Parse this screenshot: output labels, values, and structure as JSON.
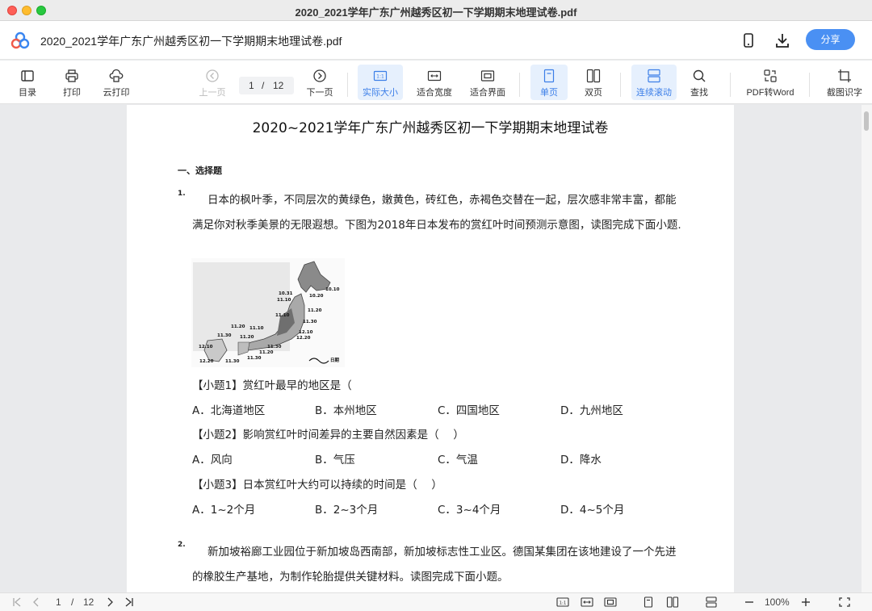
{
  "window": {
    "title": "2020_2021学年广东广州越秀区初一下学期期末地理试卷.pdf"
  },
  "header": {
    "doc_title": "2020_2021学年广东广州越秀区初一下学期期末地理试卷.pdf",
    "share_label": "分享"
  },
  "toolbar": {
    "toc": "目录",
    "print": "打印",
    "cloud_print": "云打印",
    "prev_page": "上一页",
    "current_page": "1",
    "separator": "/",
    "total_pages": "12",
    "next_page": "下一页",
    "actual_size": "实际大小",
    "fit_width": "适合宽度",
    "fit_page": "适合界面",
    "single_page": "单页",
    "double_page": "双页",
    "continuous": "连续滚动",
    "find": "查找",
    "pdf_to_word": "PDF转Word",
    "screenshot_ocr": "截图识字",
    "actual_size_icon_text": "1:1"
  },
  "document": {
    "title": "2020~2021学年广东广州越秀区初一下学期期末地理试卷",
    "section": "一、选择题",
    "q1": {
      "num": "1.",
      "line1": "日本的枫叶季，不同层次的黄绿色，嫩黄色，砖红色，赤褐色交替在一起，层次感非常丰富，都能",
      "line2": "满足你对秋季美景的无限遐想。下图为2018年日本发布的赏红叶时间预测示意图，读图完成下面小题.",
      "map_labels": [
        "10.10",
        "10.20",
        "10.31",
        "11.10",
        "11.20",
        "11.10",
        "11.30",
        "11.20",
        "11.10",
        "12.10",
        "12.20",
        "11.30",
        "11.20",
        "12.10",
        "12.20",
        "11.30",
        "11.30",
        "11.20",
        "11.30",
        "日期"
      ],
      "sub1": "【小题1】赏红叶最早的地区是（",
      "sub1_opts": [
        "A．北海道地区",
        "B．本州地区",
        "C．四国地区",
        "D．九州地区"
      ],
      "sub2": "【小题2】影响赏红叶时间差异的主要自然因素是（　 ）",
      "sub2_opts": [
        "A．风向",
        "B．气压",
        "C．气温",
        "D．降水"
      ],
      "sub3": "【小题3】日本赏红叶大约可以持续的时间是（　 ）",
      "sub3_opts": [
        "A．1~2个月",
        "B．2~3个月",
        "C．3~4个月",
        "D．4~5个月"
      ]
    },
    "q2": {
      "num": "2.",
      "line1": "新加坡裕廊工业园位于新加坡岛西南部，新加坡标志性工业区。德国某集团在该地建设了一个先进",
      "line2": "的橡胶生产基地，为制作轮胎提供关键材料。读图完成下面小题。"
    }
  },
  "statusbar": {
    "current_page": "1",
    "separator": "/",
    "total_pages": "12",
    "zoom": "100%",
    "actual_size_icon_text": "1:1"
  }
}
